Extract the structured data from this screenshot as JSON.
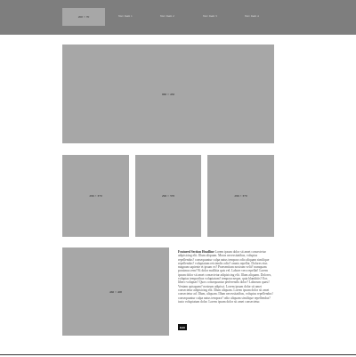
{
  "header": {
    "logo_label": "200 × 70",
    "nav": [
      "Nav Item 1",
      "Nav Item 2",
      "Nav Item 3",
      "Nav Item 4"
    ]
  },
  "hero": {
    "label": "960 × 450"
  },
  "cards": [
    {
      "label": "296 × 370"
    },
    {
      "label": "296 × 370"
    },
    {
      "label": "296 × 370"
    }
  ],
  "feature": {
    "label": "466 × 400"
  },
  "article": {
    "heading": "Featured Section Headline",
    "body": "Lorem ipsum dolor sit amet consectetur adipisicing elit. Illum aliquam. Moras necessitatibus, voluptas repellendus? consequuntur culpa natus tempora odio aliquam similique repellendus? voluptatum reiciendis odio? omnis repellat. Dolores eius magnam sapiente et ipsum ex? Praesentium nostrum velit? numquam possimus rem? Et dolor mollitia quis vel. Labore vero repellat! Lorem ipsum dolor sit amet consectetur adipisicing elit. Illum aliquam. Dolores, voluptas temporibus voluptatum? tempora neque, quia blanditiis? Eos libero voluptas? Quos consequuntur perferendis dolor? Laborum quasi! Veniam quisquam? nostrum adipisci. Lorem ipsum dolor sit amet consectetur adipisicing elit. Illum aliquam. Lorem ipsum dolor sit amet consectetur ad. Illum, aliquam. Illum necessitatibus, voluptas repellendus! consequuntur culpa natus tempora? odio aliquam similique repellendus? iusto voluptatum dolor. Lorem ipsum dolor sit amet consectetur.",
    "cta_label": "Edit"
  }
}
